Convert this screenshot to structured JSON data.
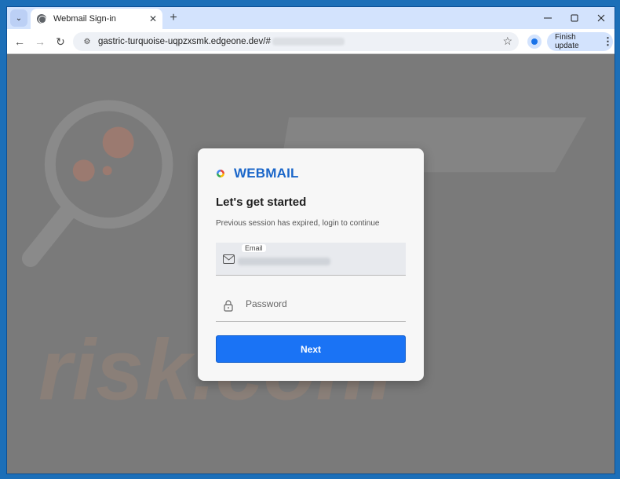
{
  "browser": {
    "tab_title": "Webmail Sign-in",
    "url": "gastric-turquoise-uqpzxsmk.edgeone.dev/#",
    "finish_update_label": "Finish update",
    "icons": {
      "tab_menu": "chevron-down-icon",
      "favicon": "globe-icon",
      "tab_close": "close-icon",
      "new_tab": "plus-icon",
      "minimize": "minimize-icon",
      "maximize": "maximize-icon",
      "close_window": "close-icon",
      "back": "back-arrow-icon",
      "forward": "forward-arrow-icon",
      "reload": "reload-icon",
      "site_info": "tune-icon",
      "bookmark": "star-icon",
      "profile": "person-icon",
      "menu": "kebab-icon"
    }
  },
  "login": {
    "brand": "WEBMAIL",
    "heading": "Let's get started",
    "subtext": "Previous session has expired, login to continue",
    "email_label": "Email",
    "password_placeholder": "Password",
    "next_label": "Next"
  },
  "colors": {
    "brand": "#1a66c9",
    "button": "#1a73f5",
    "tabstrip": "#d3e3fd"
  }
}
